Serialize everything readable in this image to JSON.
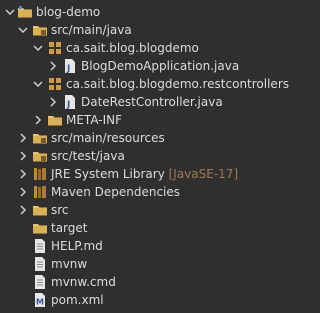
{
  "tree": {
    "project": {
      "label": "blog-demo"
    },
    "src_main_java": {
      "label": "src/main/java"
    },
    "pkg_blogdemo": {
      "label": "ca.sait.blog.blogdemo"
    },
    "file_app": {
      "label": "BlogDemoApplication.java"
    },
    "pkg_restcontrollers": {
      "label": "ca.sait.blog.blogdemo.restcontrollers"
    },
    "file_controller": {
      "label": "DateRestController.java"
    },
    "meta_inf": {
      "label": "META-INF"
    },
    "src_main_resources": {
      "label": "src/main/resources"
    },
    "src_test_java": {
      "label": "src/test/java"
    },
    "jre_library": {
      "label": "JRE System Library",
      "decoration": "[JavaSE-17]"
    },
    "maven_deps": {
      "label": "Maven Dependencies"
    },
    "src": {
      "label": "src"
    },
    "target": {
      "label": "target"
    },
    "help_md": {
      "label": "HELP.md"
    },
    "mvnw": {
      "label": "mvnw"
    },
    "mvnw_cmd": {
      "label": "mvnw.cmd"
    },
    "pom_xml": {
      "label": "pom.xml"
    }
  },
  "colors": {
    "background": "#2f2f2f",
    "text": "#dcdcdc",
    "decoration": "#a07a50",
    "folder": "#e8c26a",
    "package": "#d09a4a",
    "java_file": "#e6e6e6"
  },
  "icons": {
    "project": "project-folder-icon",
    "source_folder": "source-folder-icon",
    "package": "package-icon",
    "java_file": "java-file-icon",
    "folder": "folder-icon",
    "library": "library-icon",
    "text_file": "text-file-icon",
    "xml_file": "maven-pom-icon"
  }
}
